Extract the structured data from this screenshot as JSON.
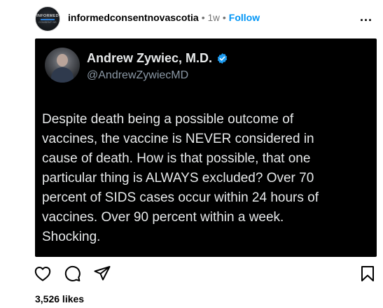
{
  "post": {
    "avatar": {
      "line1": "INFORMED",
      "line2": "CONSENT NS"
    },
    "username": "informedconsentnovascotia",
    "separator": "•",
    "time": "1w",
    "follow_label": "Follow",
    "more_label": "..."
  },
  "tweet": {
    "name": "Andrew Zywiec, M.D.",
    "handle": "@AndrewZywiecMD",
    "text": "Despite death being a possible outcome of\nvaccines, the vaccine is NEVER considered in\ncause of death. How is that possible, that one\nparticular thing is ALWAYS excluded? Over 70\npercent of SIDS cases occur within 24 hours of\nvaccines. Over 90 percent within a week.\nShocking.",
    "verified_icon": "verified-badge-icon",
    "colors": {
      "background": "#000000",
      "text": "#e7e9ea",
      "handle": "#8b98a5",
      "badge": "#1d9bf0"
    }
  },
  "actions": {
    "icons": [
      "heart-icon",
      "comment-icon",
      "share-icon",
      "bookmark-icon"
    ]
  },
  "likes": "3,526 likes",
  "colors": {
    "follow": "#0095f6",
    "muted": "#737373"
  }
}
